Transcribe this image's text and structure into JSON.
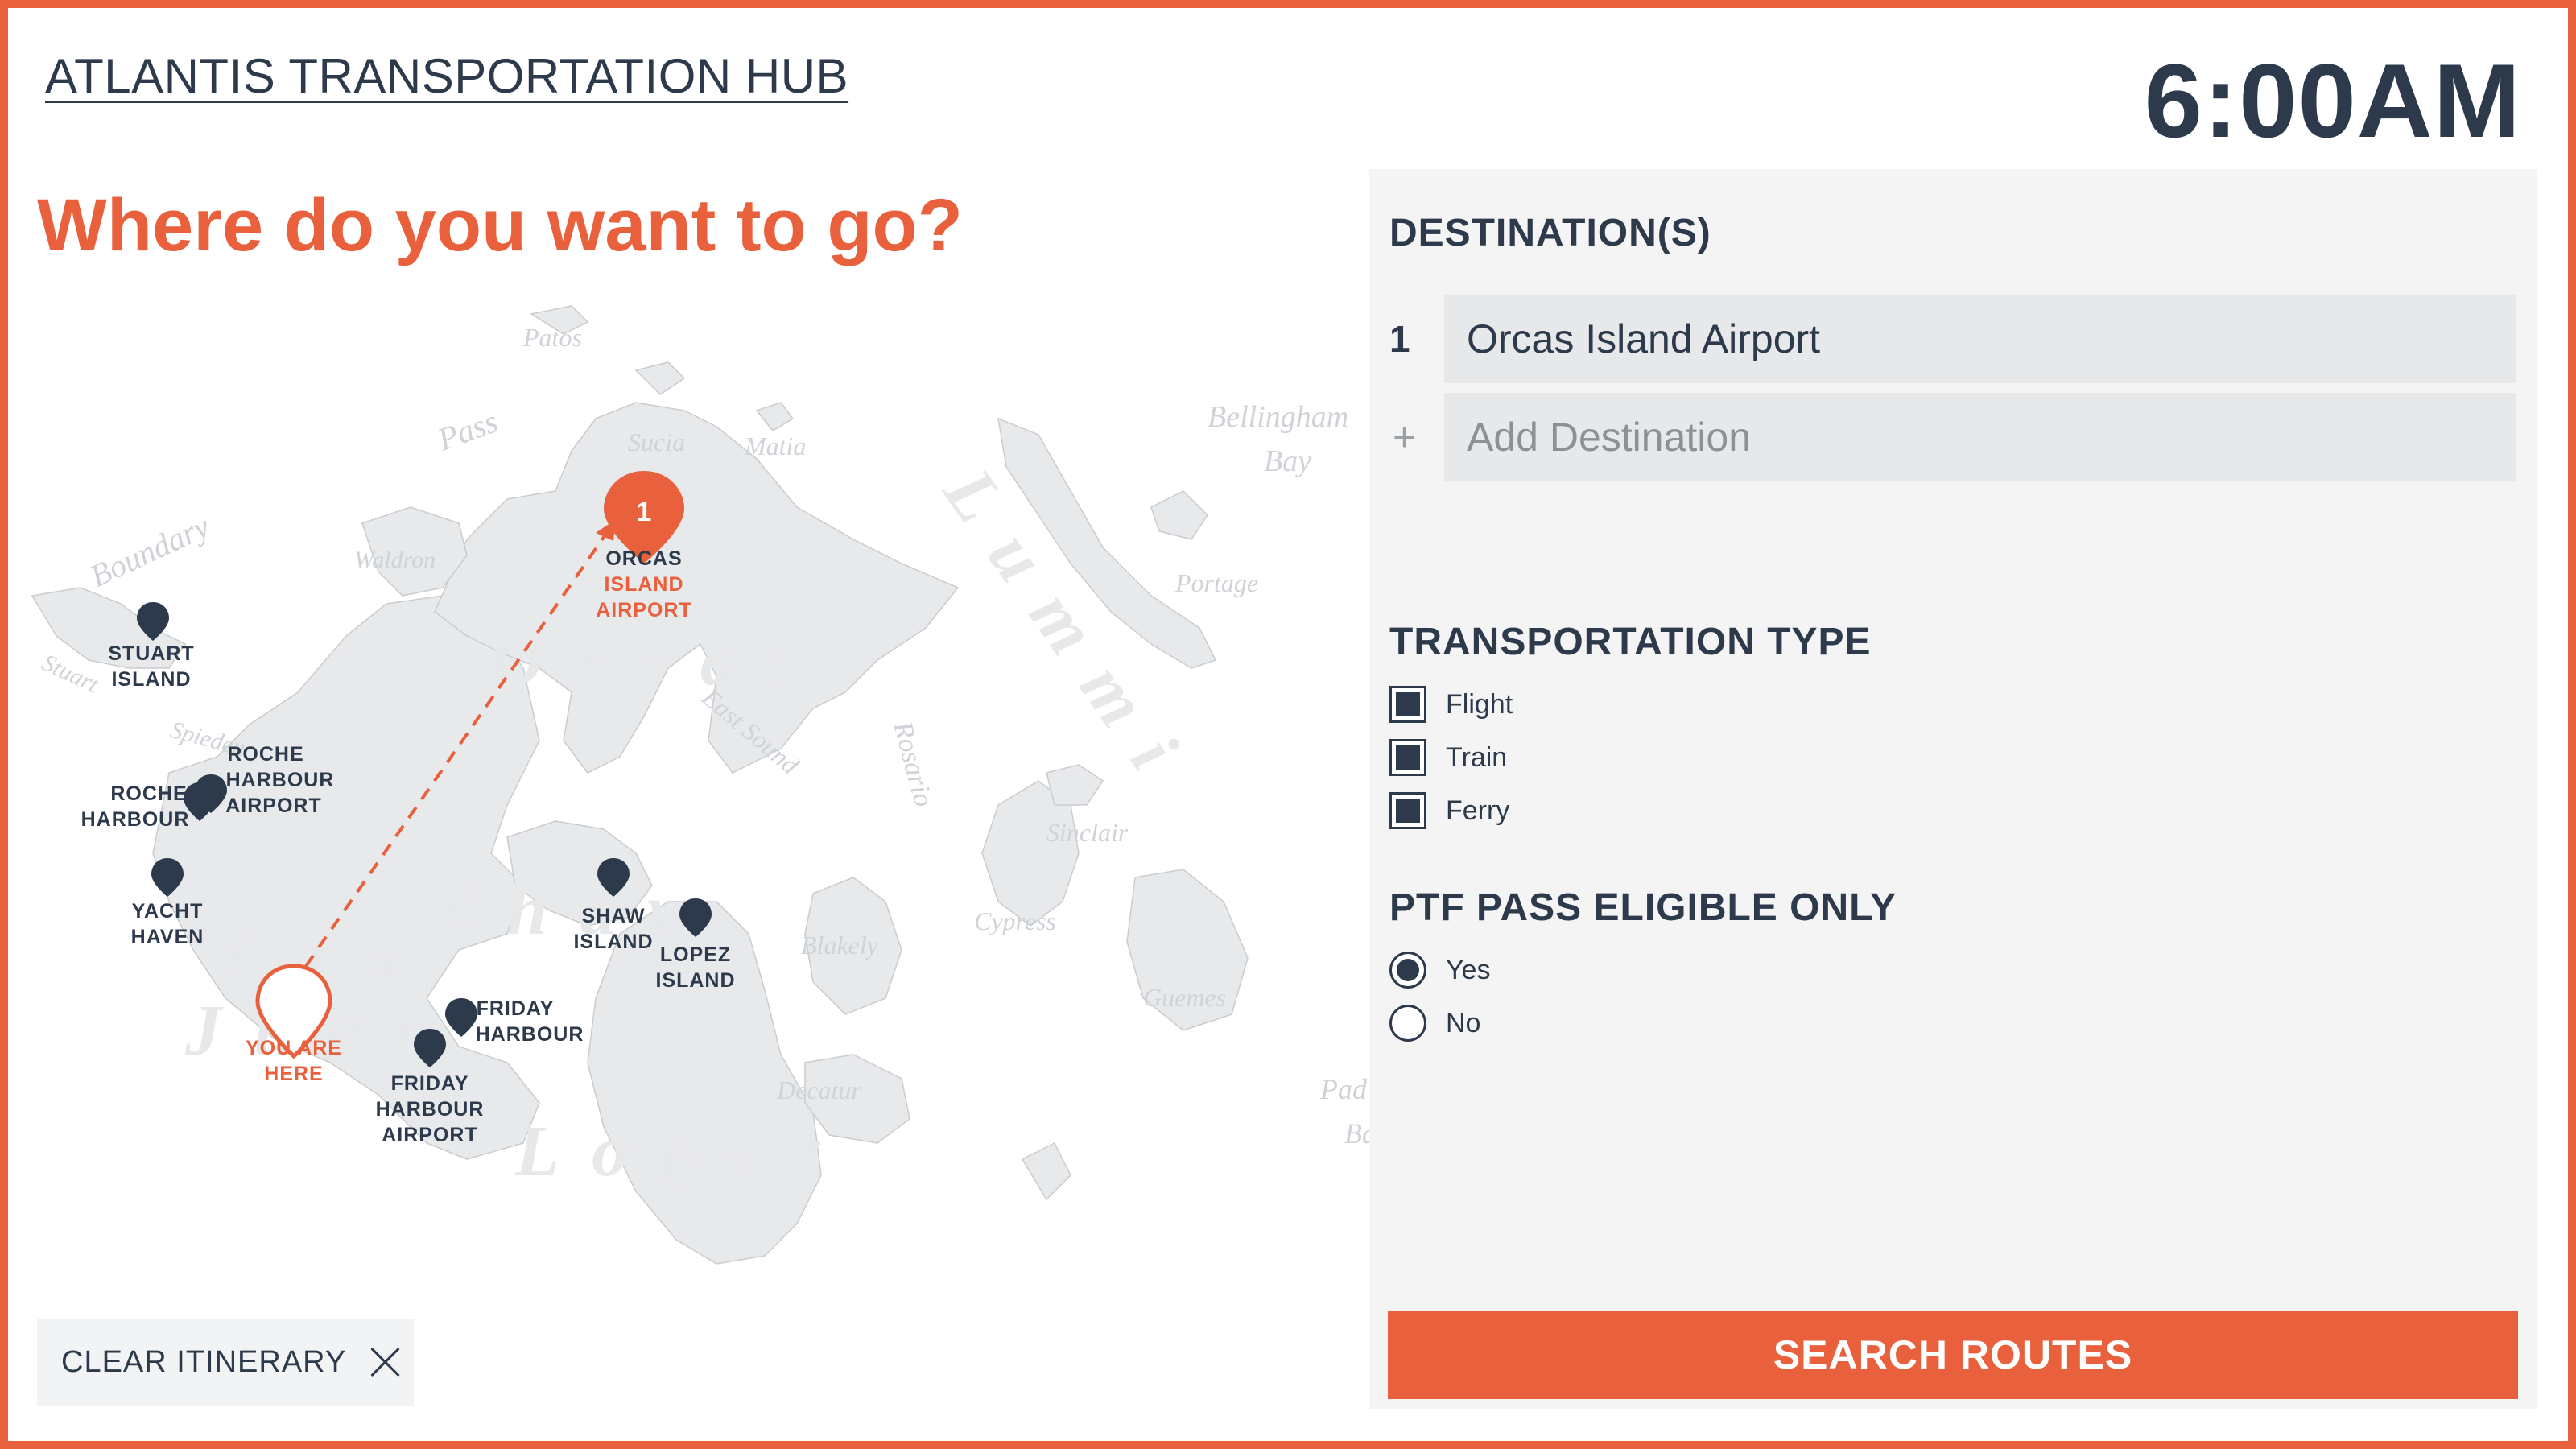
{
  "header": {
    "hub_title": "ATLANTIS TRANSPORTATION HUB",
    "clock": "6:00AM"
  },
  "main": {
    "question": "Where do you want to go?"
  },
  "map": {
    "you_are_here": [
      "YOU ARE",
      "HERE"
    ],
    "destination_pin_number": "1",
    "destination_label": [
      "ORCAS",
      "ISLAND",
      "AIRPORT"
    ],
    "locations": [
      {
        "name": "stuart-island",
        "lines": [
          "STUART",
          "ISLAND"
        ]
      },
      {
        "name": "roche-harbour-airport",
        "lines": [
          "ROCHE",
          "HARBOUR",
          "AIRPORT"
        ]
      },
      {
        "name": "roche-harbour",
        "lines": [
          "ROCHE",
          "HARBOUR"
        ]
      },
      {
        "name": "yacht-haven",
        "lines": [
          "YACHT",
          "HAVEN"
        ]
      },
      {
        "name": "shaw-island",
        "lines": [
          "SHAW",
          "ISLAND"
        ]
      },
      {
        "name": "lopez-island",
        "lines": [
          "LOPEZ",
          "ISLAND"
        ]
      },
      {
        "name": "friday-harbour",
        "lines": [
          "FRIDAY",
          "HARBOUR"
        ]
      },
      {
        "name": "friday-harbour-airport",
        "lines": [
          "FRIDAY",
          "HARBOUR",
          "AIRPORT"
        ]
      }
    ],
    "water_names": [
      "Patos",
      "Sucia",
      "Matia",
      "Bellingham",
      "Bay",
      "Portage",
      "Waldron",
      "Boundary",
      "Pass",
      "Stuart",
      "Spieden",
      "Sinclair",
      "Cypress",
      "Blakely",
      "Guemes",
      "Decatur",
      "Padilla",
      "Bay",
      "Rosario",
      "East Sound"
    ],
    "island_names": [
      "Orcas",
      "Shaw",
      "San",
      "Juan",
      "Lopez",
      "Lummi"
    ]
  },
  "clear_itinerary": {
    "label": "CLEAR ITINERARY",
    "icon": "close-icon"
  },
  "panel": {
    "destinations_title": "DESTINATION(S)",
    "destinations": [
      {
        "index": "1",
        "value": "Orcas Island Airport"
      }
    ],
    "add_destination": {
      "icon": "+",
      "placeholder": "Add Destination"
    },
    "transport_title": "TRANSPORTATION TYPE",
    "transport_options": [
      {
        "label": "Flight",
        "checked": true
      },
      {
        "label": "Train",
        "checked": true
      },
      {
        "label": "Ferry",
        "checked": true
      }
    ],
    "ptf_title": "PTF PASS ELIGIBLE ONLY",
    "ptf_options": [
      {
        "label": "Yes",
        "selected": true
      },
      {
        "label": "No",
        "selected": false
      }
    ],
    "search_button": "SEARCH ROUTES"
  },
  "colors": {
    "accent": "#e8603c",
    "text": "#2c3a4b",
    "panel_bg": "#f4f4f5",
    "land": "#e8e9eb"
  }
}
